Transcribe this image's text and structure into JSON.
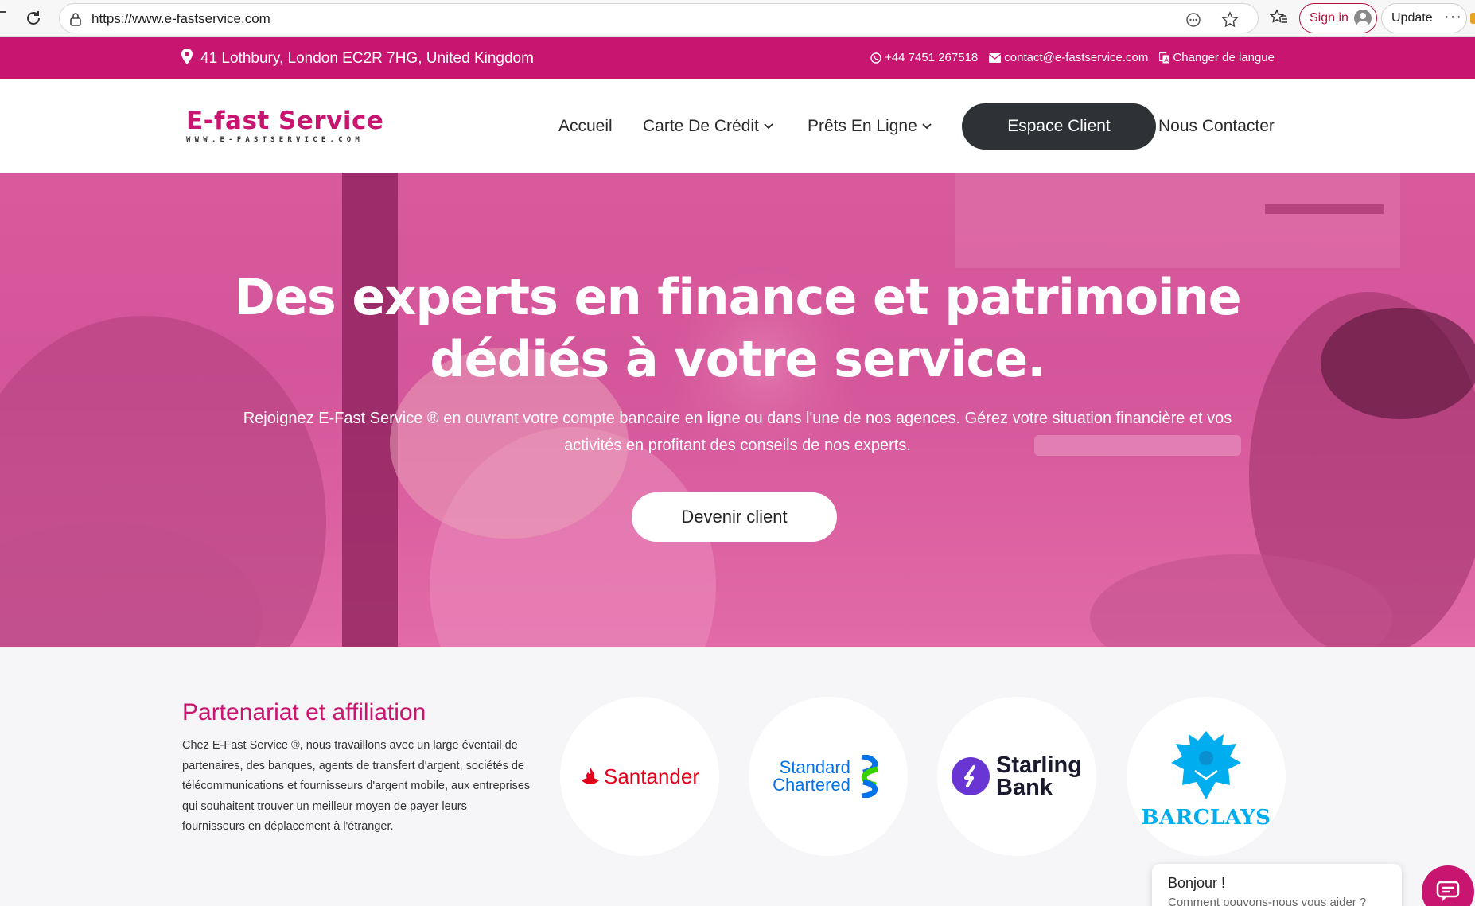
{
  "browser": {
    "url": "https://www.e-fastservice.com",
    "signin_label": "Sign in",
    "update_label": "Update",
    "more_label": "···"
  },
  "topbar": {
    "address": "41 Lothbury, London EC2R 7HG, United Kingdom",
    "phone": "+44 7451 267518",
    "email": "contact@e-fastservice.com",
    "language": "Changer de langue"
  },
  "nav": {
    "logo_text": "E-fast Service",
    "logo_sub": "WWW.E-FASTSERVICE.COM",
    "items": [
      {
        "label": "Accueil"
      },
      {
        "label": "Carte De Crédit"
      },
      {
        "label": "Prêts En Ligne"
      },
      {
        "label": "Espace Client"
      },
      {
        "label": "Nous Contacter"
      }
    ]
  },
  "hero": {
    "title_line1": "Des experts en finance et patrimoine",
    "title_line2": "dédiés à votre service.",
    "subtitle": "Rejoignez E-Fast Service ® en ouvrant votre compte bancaire en ligne ou dans l'une de nos agences. Gérez votre situation financière et vos activités en profitant des conseils de nos experts.",
    "cta": "Devenir client"
  },
  "partners": {
    "title": "Partenariat et affiliation",
    "text": "Chez E-Fast Service ®, nous travaillons avec un large éventail de partenaires, des banques, agents de transfert d'argent, sociétés de télécommunications et fournisseurs d'argent mobile, aux entreprises qui souhaitent trouver un meilleur moyen de payer leurs fournisseurs en déplacement à l'étranger.",
    "logos": {
      "santander": "Santander",
      "standard_chartered_1": "Standard",
      "standard_chartered_2": "Chartered",
      "starling_1": "Starling",
      "starling_2": "Bank",
      "barclays": "BARCLAYS"
    }
  },
  "chat": {
    "title": "Bonjour !",
    "subtitle": "Comment pouvons-nous vous aider ?"
  },
  "colors": {
    "brand": "#c8156f",
    "dark": "#2e3236"
  }
}
